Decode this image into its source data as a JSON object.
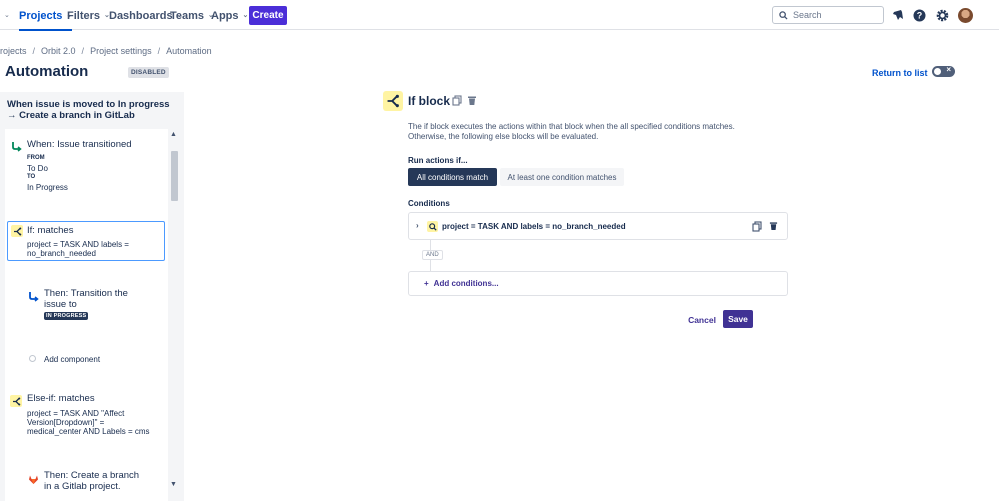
{
  "nav": {
    "items": [
      {
        "label": "Projects",
        "active": true
      },
      {
        "label": "Filters",
        "active": false
      },
      {
        "label": "Dashboards",
        "active": false
      },
      {
        "label": "Teams",
        "active": false
      },
      {
        "label": "Apps",
        "active": false
      }
    ],
    "create_label": "Create",
    "search_placeholder": "Search",
    "icons": [
      "bell-icon",
      "help-icon",
      "settings-icon"
    ]
  },
  "breadcrumb": [
    "Projects",
    "Orbit 2.0",
    "Project settings",
    "Automation"
  ],
  "page": {
    "title": "Automation",
    "status_badge": "DISABLED",
    "return_link": "Return to list"
  },
  "rule": {
    "title": "When issue is moved to In progress → Create a branch in GitLab",
    "trigger": {
      "title": "When: Issue transitioned",
      "from_label": "FROM",
      "from_value": "To Do",
      "to_label": "TO",
      "to_value": "In Progress"
    },
    "if_block": {
      "title": "If: matches",
      "text": "project = TASK AND labels = no_branch_needed"
    },
    "then_transition": {
      "title": "Then: Transition the issue to",
      "status": "IN PROGRESS"
    },
    "add_component": "Add component",
    "else_if": {
      "title": "Else-if: matches",
      "text": "project = TASK AND \"Affect Version[Dropdown]\" = medical_center AND Labels = cms"
    },
    "then_branch": {
      "title": "Then: Create a branch in a Gitlab project."
    }
  },
  "editor": {
    "title": "If block",
    "description": "The if block executes the actions within that block when the all specified conditions matches. Otherwise, the following else blocks will be evaluated.",
    "run_label": "Run actions if...",
    "options": [
      "All conditions match",
      "At least one condition matches"
    ],
    "selected_option": "All conditions match",
    "conditions_label": "Conditions",
    "condition_text": "project = TASK AND labels = no_branch_needed",
    "and_label": "AND",
    "add_conditions": "Add conditions...",
    "cancel": "Cancel",
    "save": "Save"
  },
  "colors": {
    "brand": "#4b2ed8",
    "primary_button": "#403294",
    "selected_segment": "#253858",
    "if_icon_bg": "#fff4a3",
    "trigger_icon": "#00875a",
    "gitlab_icon": "#e24329"
  }
}
